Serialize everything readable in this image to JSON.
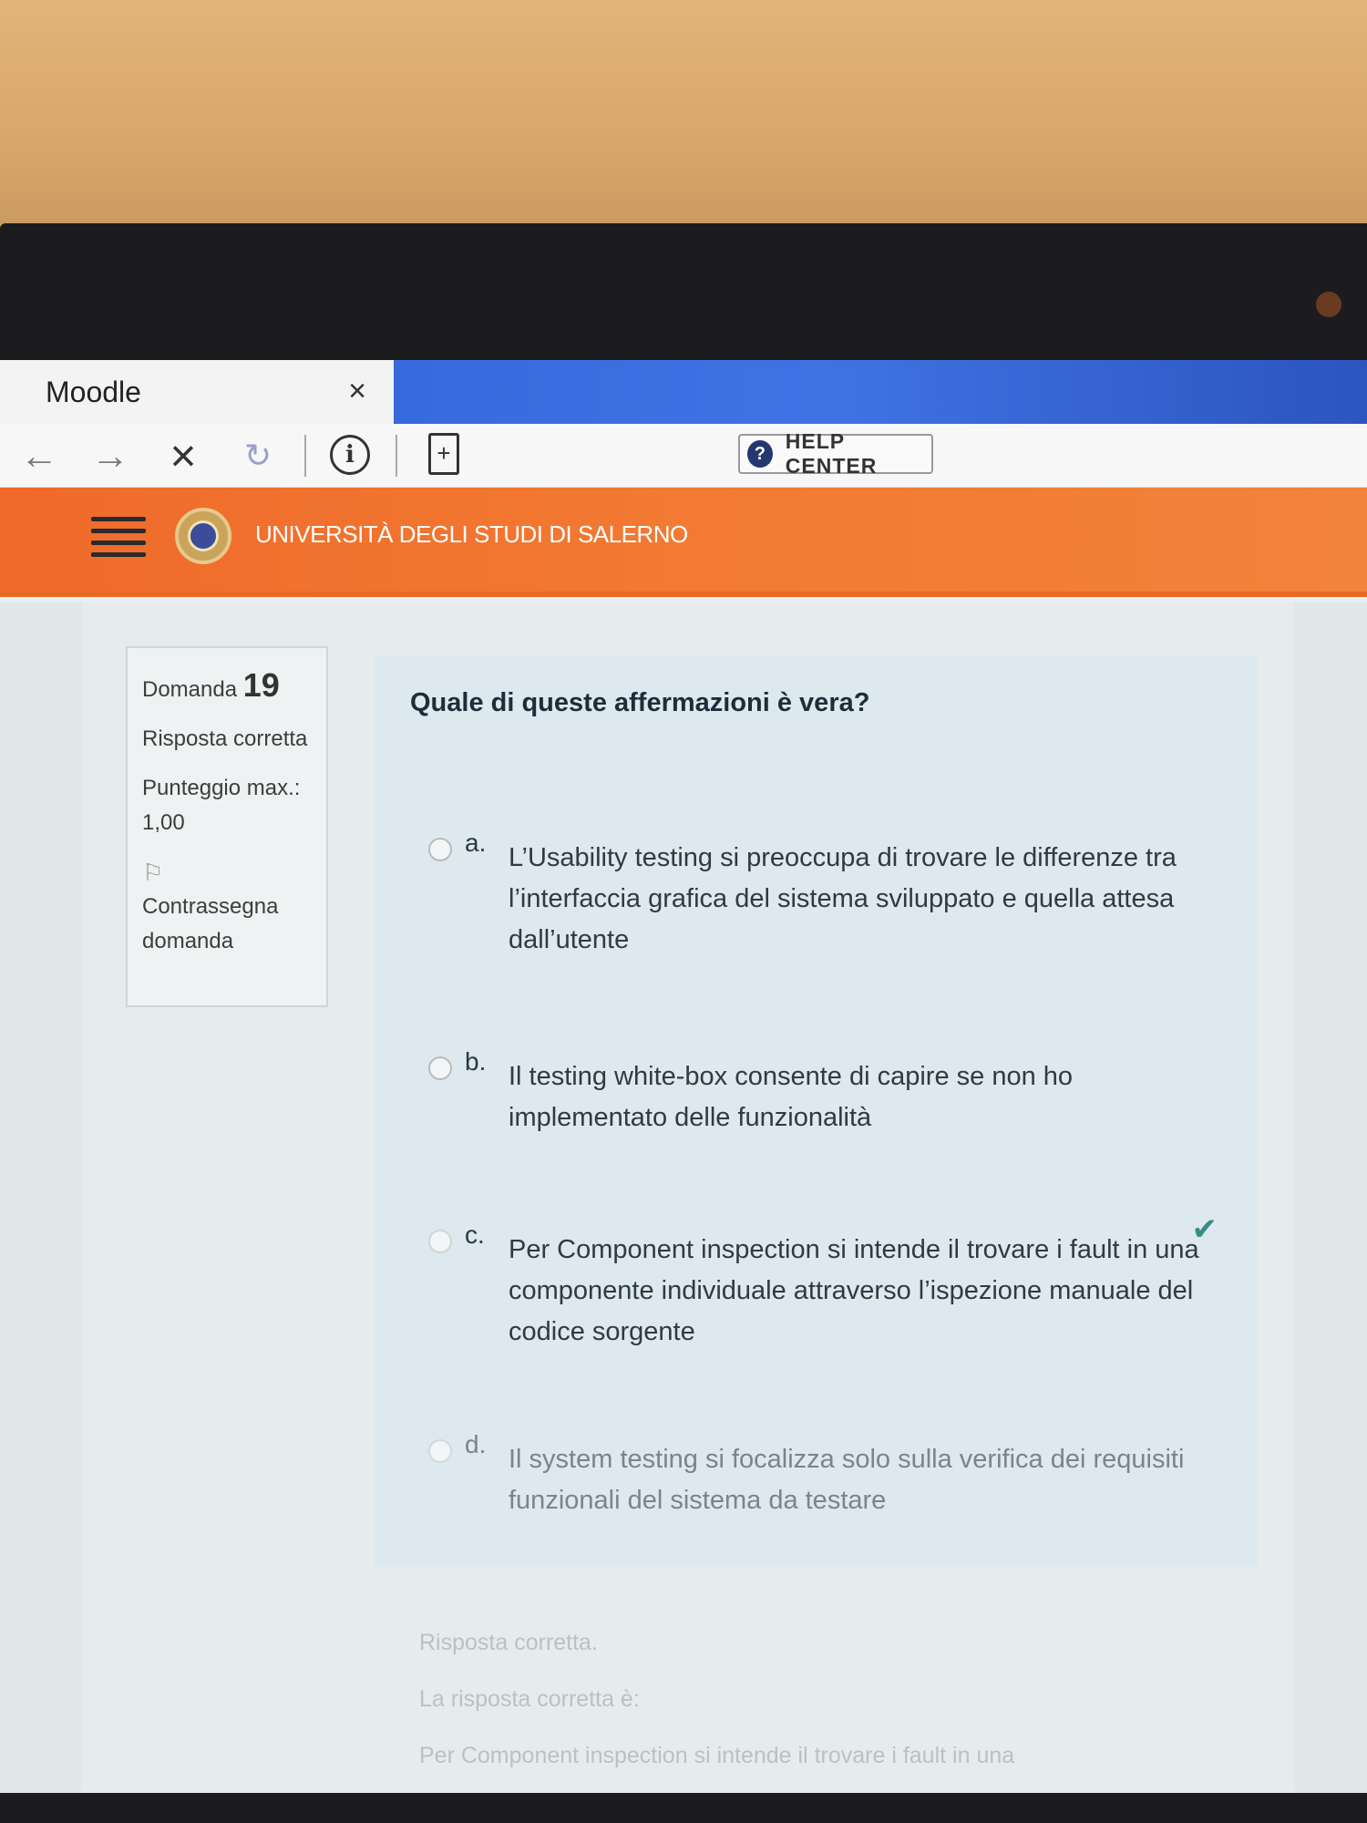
{
  "browser": {
    "tab_title": "Moodle",
    "tab_close": "×",
    "nav": {
      "back": "←",
      "forward": "→",
      "stop": "×",
      "reload": "↻",
      "info": "i",
      "doc": "+"
    },
    "help_center": {
      "icon": "?",
      "label": "HELP CENTER"
    }
  },
  "site": {
    "name": "UNIVERSITÀ DEGLI STUDI DI SALERNO"
  },
  "question_info": {
    "label": "Domanda",
    "number": "19",
    "status": "Risposta corretta",
    "max_score": "Punteggio max.: 1,00",
    "flag_label": "Contrassegna domanda"
  },
  "question": {
    "text": "Quale di queste affermazioni è vera?",
    "answers": [
      {
        "letter": "a.",
        "text": "L’Usability testing si preoccupa di trovare le differenze tra l’interfaccia grafica del sistema sviluppato e quella attesa dall’utente"
      },
      {
        "letter": "b.",
        "text": "Il testing white-box consente di capire se non ho implementato delle funzionalità"
      },
      {
        "letter": "c.",
        "text": "Per Component inspection si intende il trovare i fault in una componente individuale attraverso l’ispezione manuale del codice sorgente"
      },
      {
        "letter": "d.",
        "text": "Il system testing si focalizza solo sulla verifica dei requisiti funzionali del sistema da testare"
      }
    ]
  },
  "feedback": {
    "line1": "Risposta corretta.",
    "line2": "La risposta corretta è:",
    "line3": "Per Component inspection si intende il trovare i fault in una"
  },
  "colors": {
    "header_orange": "#f27a32",
    "tabstrip_blue": "#3f73e4",
    "check_teal": "#3a8a8a"
  }
}
